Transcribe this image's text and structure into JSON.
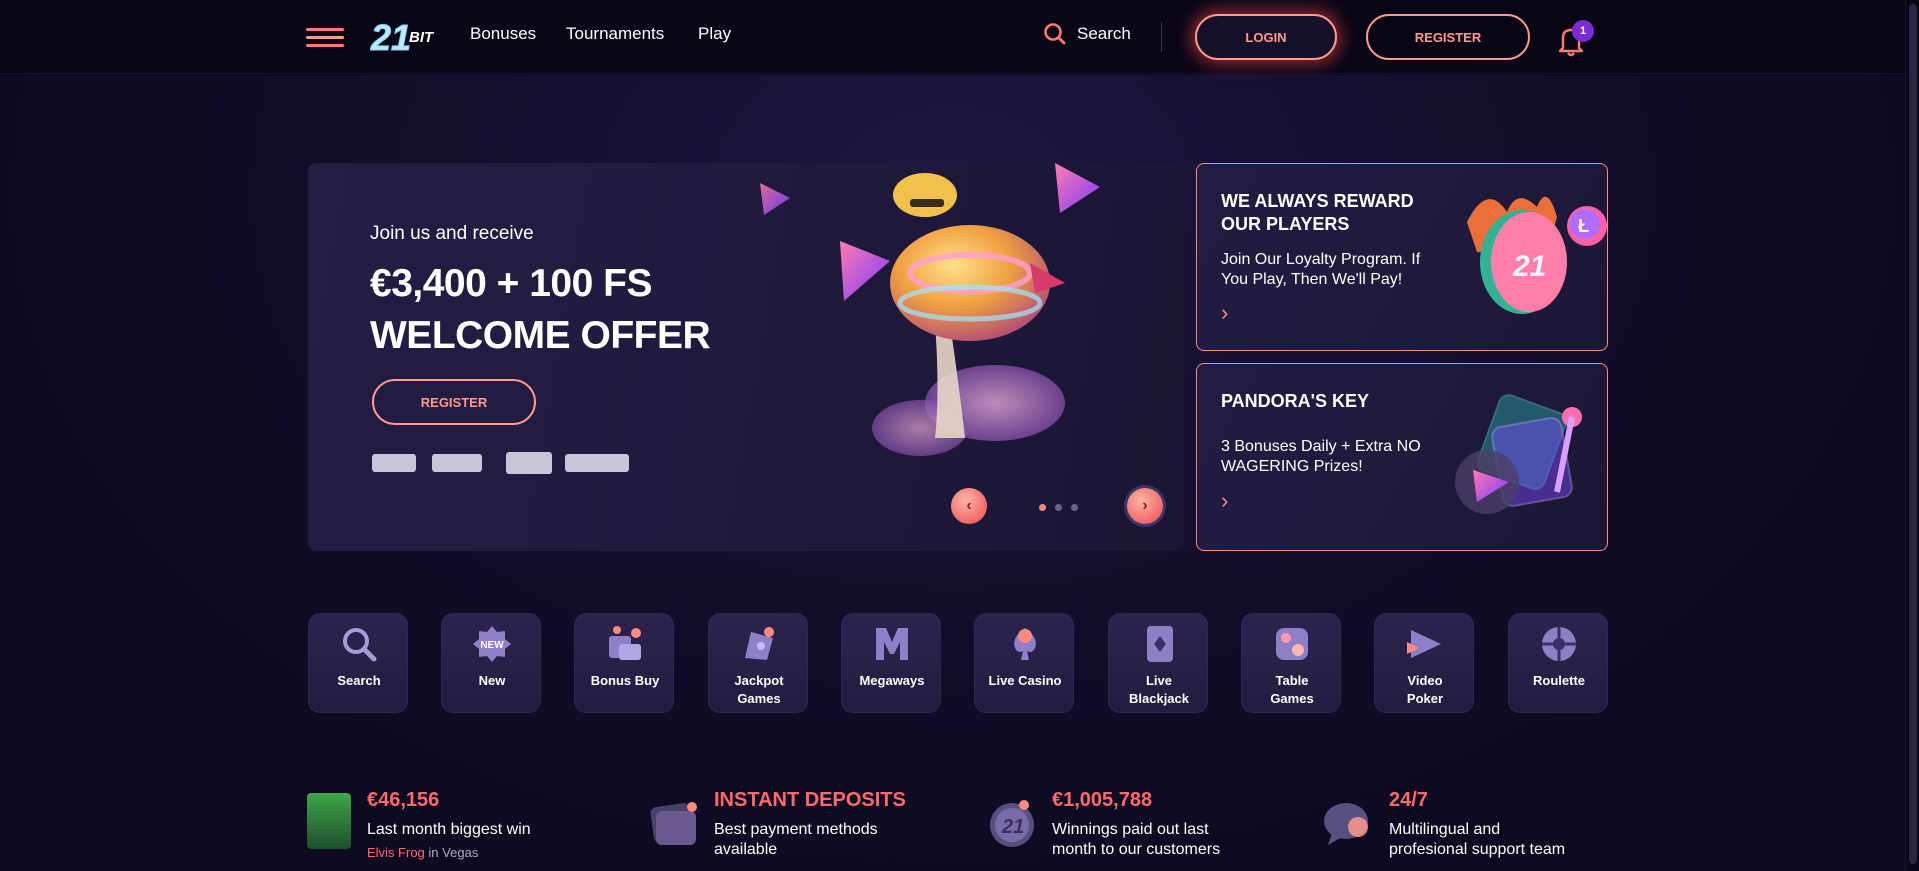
{
  "colors": {
    "accent": "#ff8a80",
    "accent_strong": "#ff6b6b",
    "background": "#0d0a21",
    "header": "#090616",
    "card": "#241d44",
    "badge": "#7a2bd6"
  },
  "header": {
    "logo_text": "21BIT",
    "nav": [
      "Bonuses",
      "Tournaments",
      "Play"
    ],
    "search_label": "Search",
    "login_label": "LOGIN",
    "register_label": "REGISTER",
    "notification_count": "1",
    "icons": [
      "hamburger-menu-icon",
      "search-icon",
      "bell-icon"
    ]
  },
  "hero": {
    "kicker": "Join us and receive",
    "title_line1": "€3,400 + 100 FS",
    "title_line2": "WELCOME OFFER",
    "register_label": "REGISTER",
    "payment_logos": [
      "payment-logo-1",
      "payment-logo-2",
      "payment-logo-3",
      "payment-logo-4"
    ],
    "prev_icon": "chevron-left-icon",
    "next_icon": "chevron-right-icon",
    "slides_total": 3,
    "slide_active": 1,
    "prev_glyph": "‹",
    "next_glyph": "›"
  },
  "promos": [
    {
      "title": "WE ALWAYS REWARD OUR PLAYERS",
      "text": "Join Our Loyalty Program. If You Play, Then We'll Pay!",
      "arrow": "›"
    },
    {
      "title": "PANDORA'S KEY",
      "text": "3 Bonuses Daily + Extra NO WAGERING Prizes!",
      "arrow": "›"
    }
  ],
  "categories": [
    {
      "label": "Search",
      "icon": "search-icon"
    },
    {
      "label": "New",
      "icon": "new-badge-icon",
      "badge_text": "NEW"
    },
    {
      "label": "Bonus Buy",
      "icon": "bonus-buy-icon"
    },
    {
      "label": "Jackpot Games",
      "icon": "jackpot-icon"
    },
    {
      "label": "Megaways",
      "icon": "megaways-icon"
    },
    {
      "label": "Live Casino",
      "icon": "live-casino-icon"
    },
    {
      "label": "Live Blackjack",
      "icon": "playing-card-icon"
    },
    {
      "label": "Table Games",
      "icon": "dice-icon"
    },
    {
      "label": "Video Poker",
      "icon": "video-poker-icon"
    },
    {
      "label": "Roulette",
      "icon": "roulette-icon"
    }
  ],
  "stats": [
    {
      "head": "€46,156",
      "line1": "Last month biggest win",
      "player": "Elvis Frog",
      "in_word": "in",
      "game": "Vegas",
      "icon": "game-thumbnail-icon"
    },
    {
      "head": "INSTANT DEPOSITS",
      "line1": "Best payment methods",
      "line2": "available",
      "icon": "wallet-icon"
    },
    {
      "head": "€1,005,788",
      "line1": "Winnings paid out last",
      "line2": "month to our customers",
      "icon": "coin-icon"
    },
    {
      "head": "24/7",
      "line1": "Multilingual and",
      "line2": "profesional support team",
      "icon": "chat-bubble-icon"
    }
  ]
}
